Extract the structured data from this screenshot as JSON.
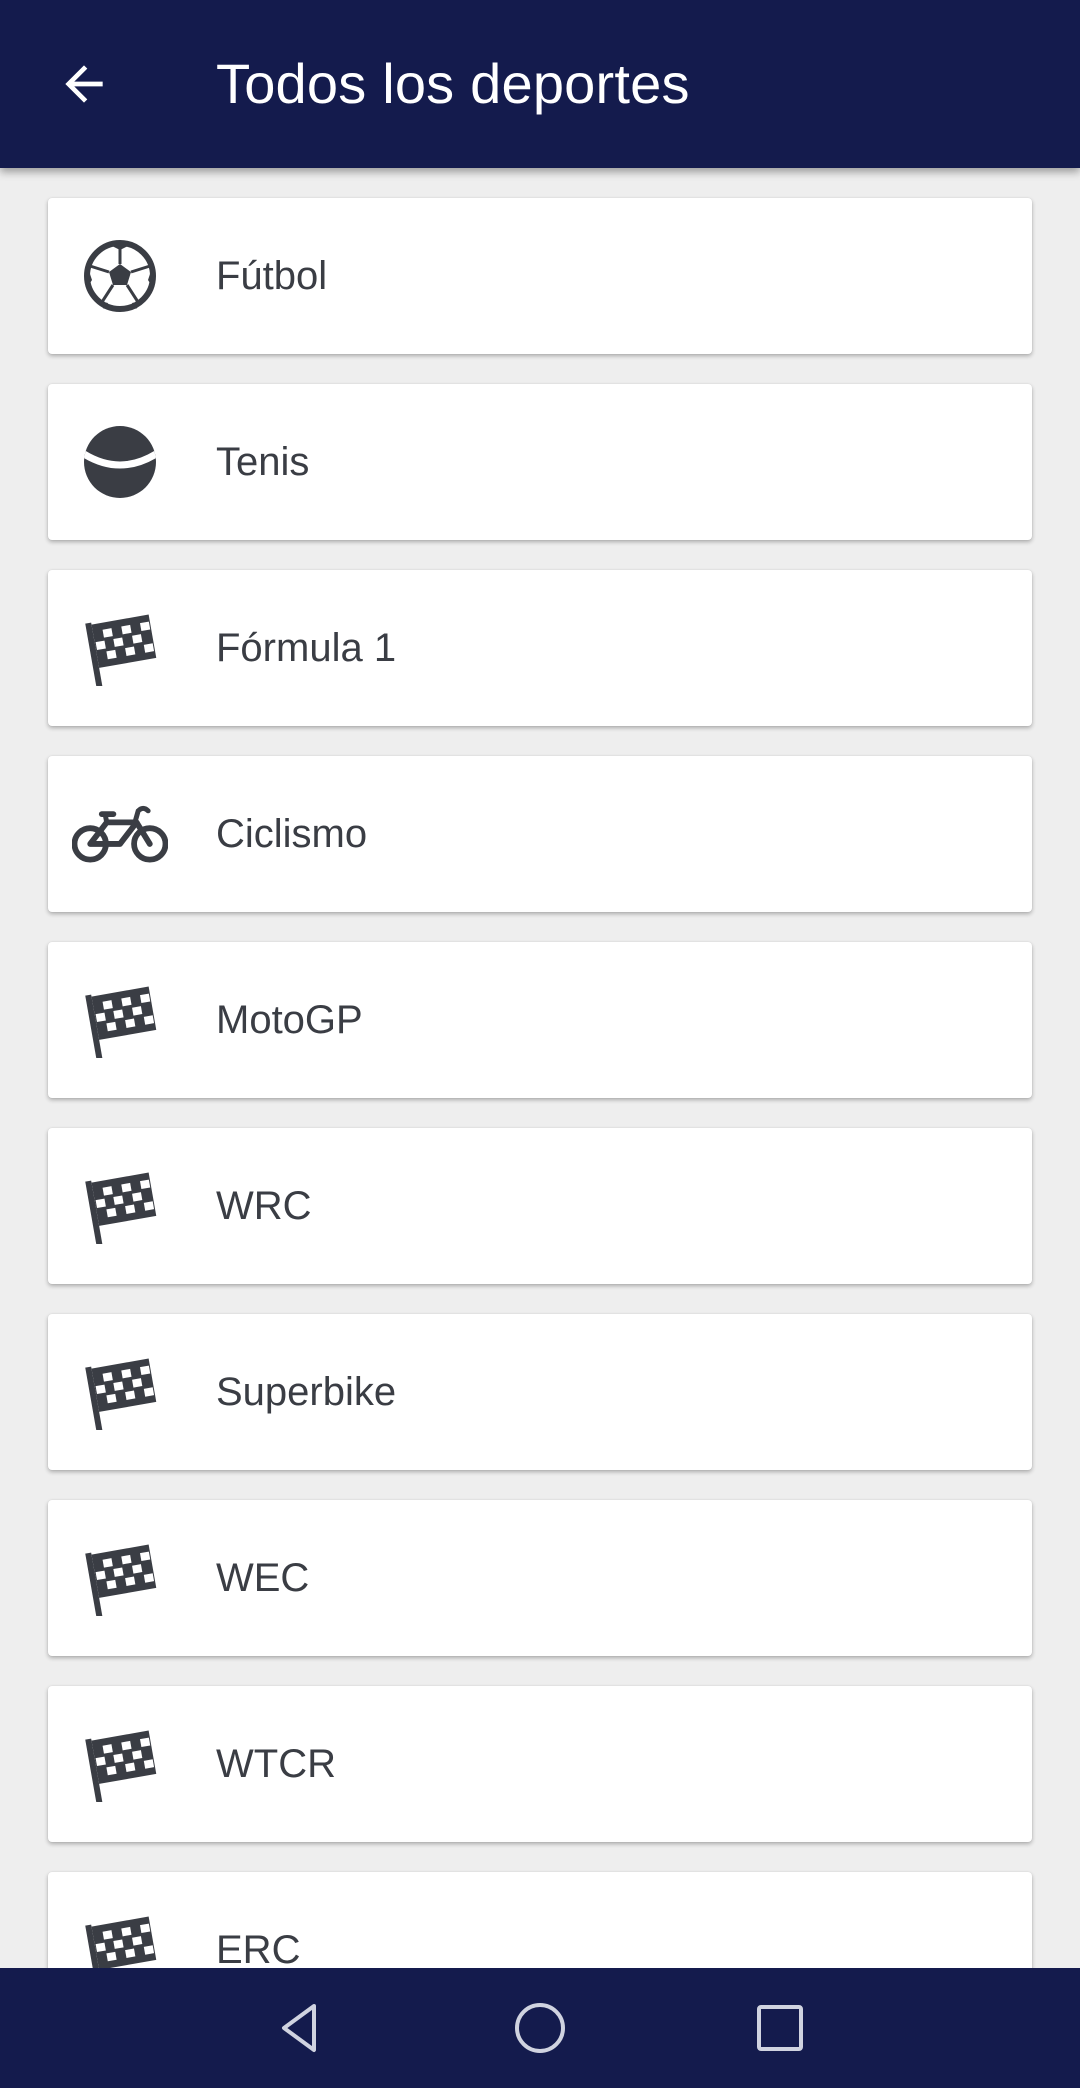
{
  "header": {
    "title": "Todos los deportes",
    "back_icon": "arrow-back-icon"
  },
  "colors": {
    "app_bar": "#141b4d",
    "background": "#eeeeee",
    "card": "#ffffff",
    "text": "#3a3d44",
    "icon": "#3a3d44"
  },
  "sports": [
    {
      "label": "Fútbol",
      "icon": "soccer-ball-icon"
    },
    {
      "label": "Tenis",
      "icon": "tennis-ball-icon"
    },
    {
      "label": "Fórmula 1",
      "icon": "checkered-flag-icon"
    },
    {
      "label": "Ciclismo",
      "icon": "bicycle-icon"
    },
    {
      "label": "MotoGP",
      "icon": "checkered-flag-icon"
    },
    {
      "label": "WRC",
      "icon": "checkered-flag-icon"
    },
    {
      "label": "Superbike",
      "icon": "checkered-flag-icon"
    },
    {
      "label": "WEC",
      "icon": "checkered-flag-icon"
    },
    {
      "label": "WTCR",
      "icon": "checkered-flag-icon"
    },
    {
      "label": "ERC",
      "icon": "checkered-flag-icon"
    }
  ],
  "navigation": {
    "back": "nav-back-icon",
    "home": "nav-home-icon",
    "recents": "nav-recents-icon"
  }
}
